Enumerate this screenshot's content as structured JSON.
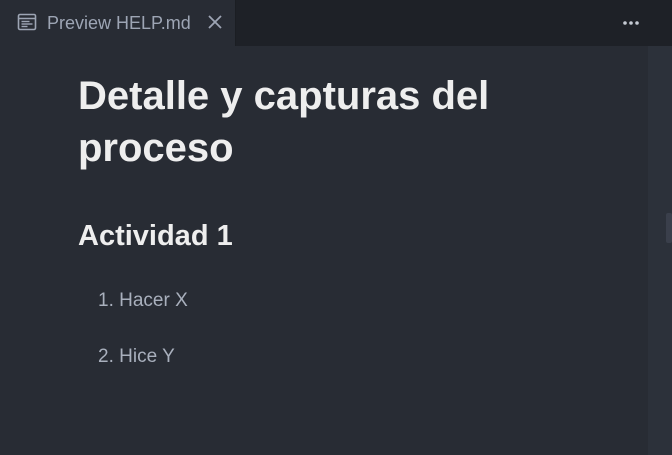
{
  "tab": {
    "title": "Preview HELP.md",
    "icon": "markdown-preview-icon",
    "close_icon": "close-icon"
  },
  "toolbar": {
    "more_icon": "more-options-icon"
  },
  "document": {
    "heading1": "Detalle y capturas del proceso",
    "heading2": "Actividad 1",
    "list": [
      {
        "number": "1.",
        "text": "Hacer X"
      },
      {
        "number": "2.",
        "text": "Hice Y"
      }
    ]
  },
  "colors": {
    "background": "#282c34",
    "tabbar": "#1e2127",
    "heading": "#eeeeee",
    "list_text": "#a9b0bd"
  }
}
